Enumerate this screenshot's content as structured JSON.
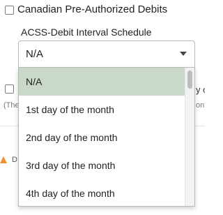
{
  "options_section": {
    "checkbox_label": "Canadian Pre-Authorized Debits"
  },
  "interval_select": {
    "label": "ACSS-Debit Interval Schedule",
    "selected_value": "N/A",
    "options": [
      "N/A",
      "1st day of the month",
      "2nd day of the month",
      "3rd day of the month",
      "4th day of the month"
    ]
  },
  "background_fragments": {
    "the": "(The",
    "y": "y o",
    "on": "on",
    "d": "D"
  },
  "colors": {
    "selected_option_bg": "#c9d8c9",
    "warning": "#f0902a"
  }
}
